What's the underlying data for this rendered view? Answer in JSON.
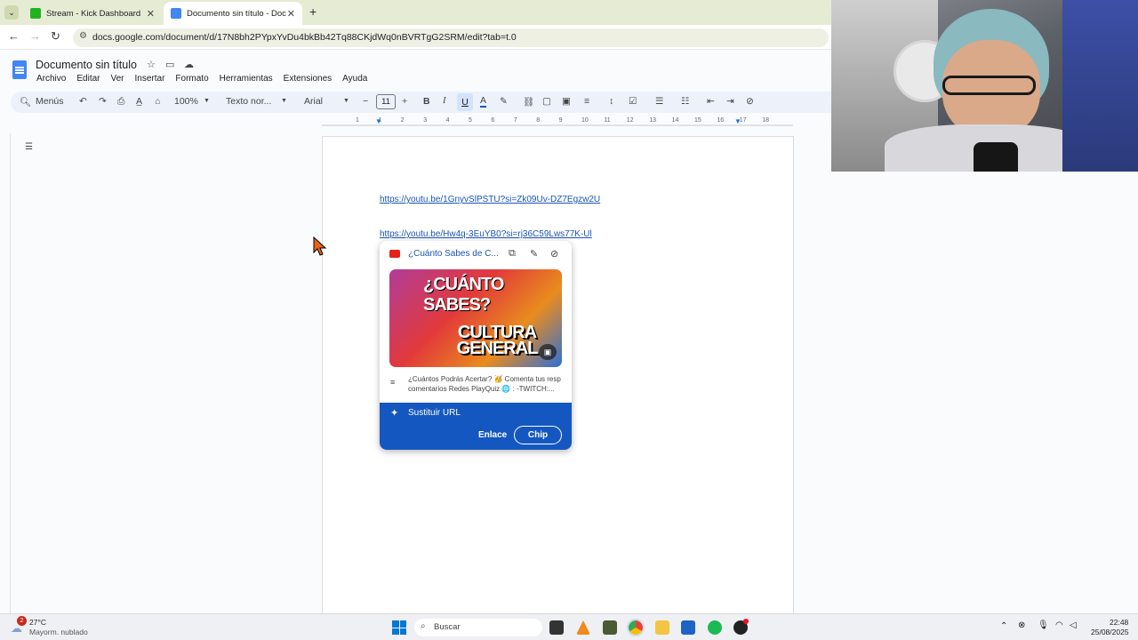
{
  "browser": {
    "tabs": [
      {
        "title": "Stream - Kick Dashboard",
        "favicon_color": "#1fb31f"
      },
      {
        "title": "Documento sin título - Docume",
        "favicon_color": "#4285f4"
      }
    ],
    "new_tab": "+",
    "url": "docs.google.com/document/d/17N8bh2PYpxYvDu4bkBb42Tq88CKjdWq0nBVRTgG2SRM/edit?tab=t.0"
  },
  "doc": {
    "title": "Documento sin título",
    "menu": [
      "Archivo",
      "Editar",
      "Ver",
      "Insertar",
      "Formato",
      "Herramientas",
      "Extensiones",
      "Ayuda"
    ],
    "toolbar": {
      "menus": "Menús",
      "zoom": "100%",
      "style": "Texto nor...",
      "font": "Arial",
      "font_size": "11"
    },
    "ruler_numbers": [
      "1",
      "1",
      "2",
      "3",
      "4",
      "5",
      "6",
      "7",
      "8",
      "9",
      "10",
      "11",
      "12",
      "13",
      "14",
      "15",
      "16",
      "17",
      "18"
    ],
    "links": [
      "https://youtu.be/1GnyvSlPSTU?si=Zk09Uv-DZ7Egzw2U",
      "https://youtu.be/Hw4q-3EuYB0?si=rj36C59Lws77K-Ul"
    ]
  },
  "preview_card": {
    "title": "¿Cuánto Sabes de C...",
    "thumb_top": "¿CUÁNTO SABES?",
    "thumb_bottom": "CULTURA GENERAL",
    "description_line1": "¿Cuántos Podrás Acertar? 🥳 Comenta tus resp",
    "description_line2": "comentarios Redes PlayQuiz 🌐 : -TWITCH:...",
    "replace_url": "Sustituir URL",
    "link_option": "Enlace",
    "chip_option": "Chip"
  },
  "taskbar": {
    "weather_temp": "27°C",
    "weather_desc": "Mayorm. nublado",
    "weather_badge": "2",
    "search": "Buscar",
    "time": "22:48",
    "date": "25/08/2025"
  }
}
